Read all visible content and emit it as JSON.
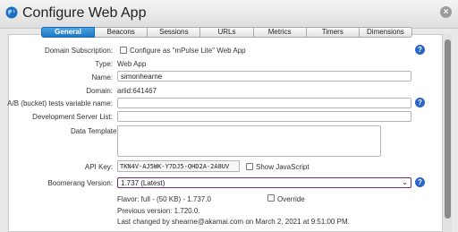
{
  "window": {
    "title": "Configure Web App",
    "close_glyph": "×"
  },
  "tabs": [
    {
      "label": "General",
      "active": true
    },
    {
      "label": "Beacons",
      "active": false
    },
    {
      "label": "Sessions",
      "active": false
    },
    {
      "label": "URLs",
      "active": false
    },
    {
      "label": "Metrics",
      "active": false
    },
    {
      "label": "Timers",
      "active": false
    },
    {
      "label": "Dimensions",
      "active": false
    }
  ],
  "form": {
    "domain_subscription_label": "Domain Subscription:",
    "domain_subscription_option": "Configure as \"mPulse Lite\" Web App",
    "type_label": "Type:",
    "type_value": "Web App",
    "name_label": "Name:",
    "name_value": "simonhearne",
    "domain_label": "Domain:",
    "domain_value": "arlid:641467",
    "ab_label": "A/B (bucket) tests variable name:",
    "ab_value": "",
    "dev_server_label": "Development Server List:",
    "dev_server_value": "",
    "data_template_label": "Data Template:",
    "data_template_value": "",
    "api_key_label": "API Key:",
    "api_key_value": "TKN4V-AJ5WK-Y7DJ5-QHD2A-2A8UV",
    "show_js_label": "Show JavaScript",
    "boomerang_label": "Boomerang Version:",
    "boomerang_value": "1.737 (Latest)",
    "flavor_text": "Flavor: full - (50 KB) - 1.737.0",
    "override_label": "Override",
    "previous_version_text": "Previous version: 1.720.0.",
    "last_changed_text": "Last changed by shearne@akamai.com on March 2, 2021 at 9:51:00 PM."
  },
  "help_glyph": "?",
  "colors": {
    "active_tab": "#1f78c4",
    "help_icon": "#2a66c8",
    "select_border": "#7a2e6e"
  }
}
